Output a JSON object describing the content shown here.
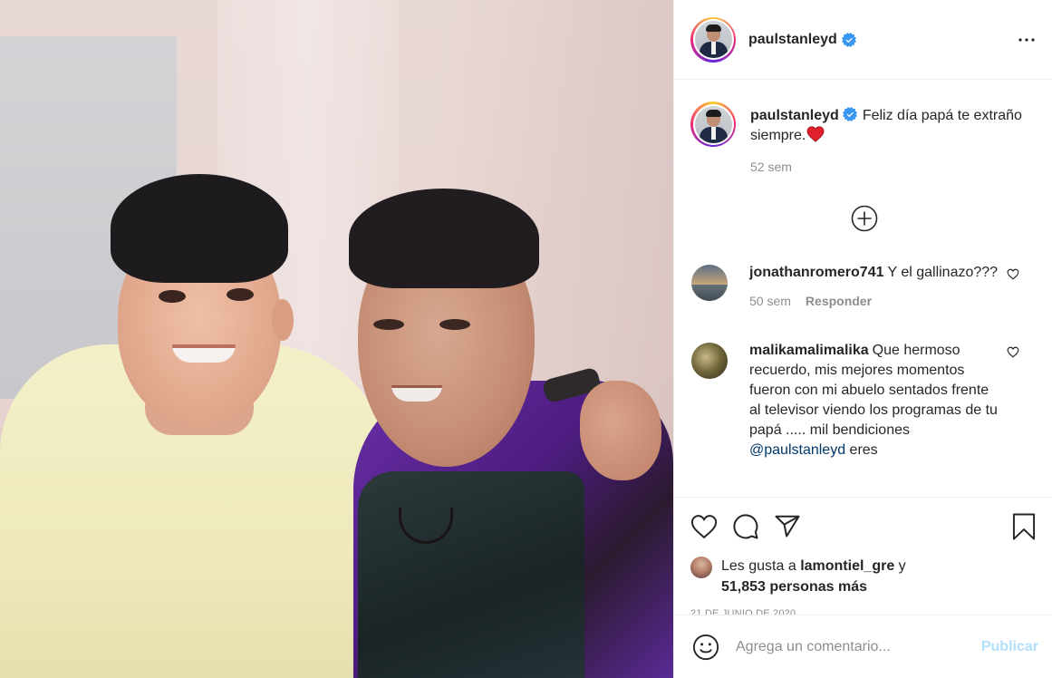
{
  "header": {
    "username": "paulstanleyd",
    "verified": true,
    "more_icon": "more-horizontal-icon"
  },
  "caption": {
    "username": "paulstanleyd",
    "text": "Feliz día papá te extraño siempre.",
    "emoji": "❤️",
    "time": "52 sem"
  },
  "load_more_icon": "plus-circle-icon",
  "comments": [
    {
      "username": "jonathanromero741",
      "text": "Y el gallinazo???",
      "time": "50 sem",
      "reply_label": "Responder"
    },
    {
      "username": "malikamalimalika",
      "text_before": "Que hermoso recuerdo, mis mejores momentos fueron con mi abuelo sentados frente al televisor viendo los programas de tu papá ..... mil bendiciones ",
      "mention": "@paulstanleyd",
      "text_after": " eres"
    }
  ],
  "actions": {
    "icons": [
      "heart-icon",
      "comment-icon",
      "share-icon",
      "bookmark-icon"
    ]
  },
  "likes": {
    "prefix": "Les gusta a",
    "liker": "lamontiel_gre",
    "conjunction": "y",
    "count": "51,853 personas más"
  },
  "date": "21 DE JUNIO DE 2020",
  "add_comment": {
    "placeholder": "Agrega un comentario...",
    "publish_label": "Publicar"
  },
  "colors": {
    "verified_blue": "#3897f0",
    "heart_red": "#ed4956",
    "publish_disabled": "#b2dffc",
    "mention_blue": "#00376b"
  }
}
